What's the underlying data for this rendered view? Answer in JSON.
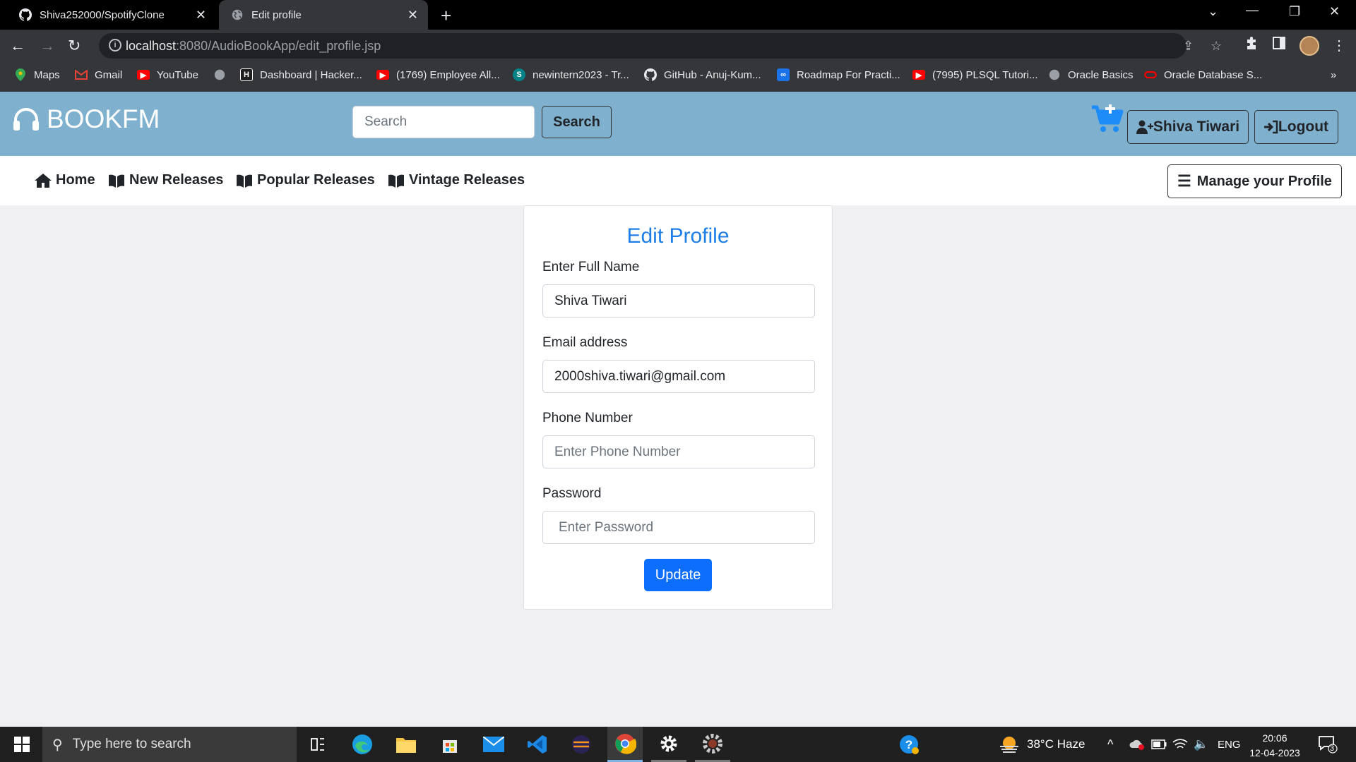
{
  "browser": {
    "tabs": [
      {
        "title": "Shiva252000/SpotifyClone",
        "icon": "github-icon",
        "active": false
      },
      {
        "title": "Edit profile",
        "icon": "globe-icon",
        "active": true
      }
    ],
    "url_host": "localhost",
    "url_path": ":8080/AudioBookApp/edit_profile.jsp",
    "bookmarks": [
      {
        "label": "Maps",
        "icon": "maps-icon",
        "color": "#34a853"
      },
      {
        "label": "Gmail",
        "icon": "gmail-icon",
        "color": "#ea4335"
      },
      {
        "label": "YouTube",
        "icon": "youtube-icon",
        "color": "#ff0000"
      },
      {
        "label": "",
        "icon": "globe-icon",
        "color": "#9aa0a6"
      },
      {
        "label": "Dashboard | Hacker...",
        "icon": "hackerrank-icon",
        "color": "#1f1f1f"
      },
      {
        "label": "(1769) Employee All...",
        "icon": "youtube-icon",
        "color": "#ff0000"
      },
      {
        "label": "newintern2023 - Tr...",
        "icon": "sharepoint-icon",
        "color": "#038387"
      },
      {
        "label": "GitHub - Anuj-Kum...",
        "icon": "github-icon",
        "color": "#ffffff"
      },
      {
        "label": "Roadmap For Practi...",
        "icon": "infinity-icon",
        "color": "#1a73e8"
      },
      {
        "label": "(7995) PLSQL Tutori...",
        "icon": "youtube-icon",
        "color": "#ff0000"
      },
      {
        "label": "Oracle Basics",
        "icon": "globe-icon",
        "color": "#9aa0a6"
      },
      {
        "label": "Oracle Database S...",
        "icon": "oracle-icon",
        "color": "#f80000"
      }
    ],
    "more_bookmarks": "»"
  },
  "site": {
    "brand": "BOOKFM",
    "search_placeholder": "Search",
    "search_button": "Search",
    "user_button": "Shiva Tiwari",
    "logout_button": "Logout",
    "nav": [
      {
        "label": "Home",
        "icon": "home-icon"
      },
      {
        "label": "New Releases",
        "icon": "book-icon"
      },
      {
        "label": "Popular Releases",
        "icon": "book-icon"
      },
      {
        "label": "Vintage Releases",
        "icon": "book-icon"
      }
    ],
    "manage_profile": "Manage your Profile",
    "colors": {
      "header": "#7fb1cf",
      "accent": "#1d7ee8",
      "primary_button": "#0d6efd",
      "cart": "#1d8cf8"
    }
  },
  "form": {
    "title": "Edit Profile",
    "name_label": "Enter Full Name",
    "name_value": "Shiva Tiwari",
    "email_label": "Email address",
    "email_value": "2000shiva.tiwari@gmail.com",
    "phone_label": "Phone Number",
    "phone_placeholder": "Enter Phone Number",
    "password_label": "Password",
    "password_placeholder": "Enter Password",
    "submit": "Update"
  },
  "taskbar": {
    "search_placeholder": "Type here to search",
    "weather": "38°C  Haze",
    "language": "ENG",
    "time": "20:06",
    "date": "12-04-2023",
    "notification_count": "3"
  }
}
